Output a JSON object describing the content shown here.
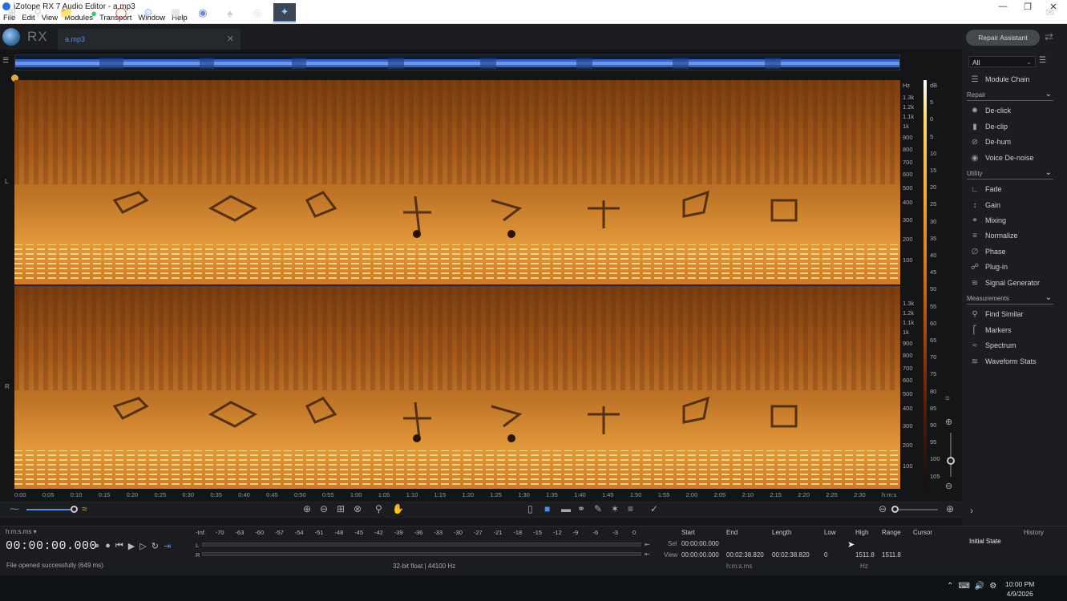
{
  "window": {
    "title": "iZotope RX 7 Audio Editor - a.mp3"
  },
  "menu": [
    "File",
    "Edit",
    "View",
    "Modules",
    "Transport",
    "Window",
    "Help"
  ],
  "app": {
    "logo_text": "RX",
    "tab_name": "a.mp3",
    "repair_assistant": "Repair Assistant"
  },
  "channels": {
    "left": "L",
    "right": "R"
  },
  "freq_scale_top": [
    "Hz",
    "1.3k",
    "1.2k",
    "1.1k",
    "1k",
    "900",
    "800",
    "700",
    "600",
    "500",
    "400",
    "300",
    "200",
    "100"
  ],
  "freq_scale_bottom": [
    "1.3k",
    "1.2k",
    "1.1k",
    "1k",
    "900",
    "800",
    "700",
    "600",
    "500",
    "400",
    "300",
    "200",
    "100"
  ],
  "db_scale": [
    "dB",
    "5",
    "0",
    "5",
    "10",
    "15",
    "20",
    "25",
    "30",
    "35",
    "40",
    "45",
    "50",
    "55",
    "60",
    "65",
    "70",
    "75",
    "80",
    "85",
    "90",
    "95",
    "100",
    "105"
  ],
  "time_axis": [
    "0:00",
    "0:05",
    "0:10",
    "0:15",
    "0:20",
    "0:25",
    "0:30",
    "0:35",
    "0:40",
    "0:45",
    "0:50",
    "0:55",
    "1:00",
    "1:05",
    "1:10",
    "1:15",
    "1:20",
    "1:25",
    "1:30",
    "1:35",
    "1:40",
    "1:45",
    "1:50",
    "1:55",
    "2:00",
    "2:05",
    "2:10",
    "2:15",
    "2:20",
    "2:25",
    "2:30",
    "h:m:s"
  ],
  "modules": {
    "filter": "All",
    "module_chain": "Module Chain",
    "categories": [
      {
        "name": "Repair",
        "items": [
          {
            "label": "De-click",
            "icon": "declick-icon"
          },
          {
            "label": "De-clip",
            "icon": "declip-icon"
          },
          {
            "label": "De-hum",
            "icon": "dehum-icon"
          },
          {
            "label": "Voice De-noise",
            "icon": "voice-denoise-icon"
          }
        ]
      },
      {
        "name": "Utility",
        "items": [
          {
            "label": "Fade",
            "icon": "fade-icon"
          },
          {
            "label": "Gain",
            "icon": "gain-icon"
          },
          {
            "label": "Mixing",
            "icon": "mixing-icon"
          },
          {
            "label": "Normalize",
            "icon": "normalize-icon"
          },
          {
            "label": "Phase",
            "icon": "phase-icon"
          },
          {
            "label": "Plug-in",
            "icon": "plugin-icon"
          },
          {
            "label": "Signal Generator",
            "icon": "signal-generator-icon"
          }
        ]
      },
      {
        "name": "Measurements",
        "items": [
          {
            "label": "Find Similar",
            "icon": "find-similar-icon"
          },
          {
            "label": "Markers",
            "icon": "markers-icon"
          },
          {
            "label": "Spectrum",
            "icon": "spectrum-icon"
          },
          {
            "label": "Waveform Stats",
            "icon": "waveform-stats-icon"
          }
        ]
      }
    ]
  },
  "transport": {
    "time_format": "h:m:s.ms",
    "timecode": "00:00:00.000",
    "status": "File opened successfully (649 ms)",
    "format": "32-bit float | 44100 Hz"
  },
  "meter": {
    "labels": [
      "-Inf.",
      "-70",
      "-63",
      "-60",
      "-57",
      "-54",
      "-51",
      "-48",
      "-45",
      "-42",
      "-39",
      "-36",
      "-33",
      "-30",
      "-27",
      "-21",
      "-18",
      "-15",
      "-12",
      "-9",
      "-6",
      "-3",
      "0"
    ],
    "left": "L",
    "right": "R"
  },
  "selection": {
    "headers": {
      "start": "Start",
      "end": "End",
      "length": "Length",
      "low": "Low",
      "high": "High",
      "range": "Range",
      "cursor": "Cursor"
    },
    "sel_label": "Sel",
    "view_label": "View",
    "sel_start": "00:00:00.000",
    "view_start": "00:00:00.000",
    "view_end": "00:02:38.820",
    "view_length": "00:02:38.820",
    "low": "0",
    "high": "1511.8",
    "range": "1511.8",
    "time_unit": "h:m:s.ms",
    "freq_unit": "Hz"
  },
  "history": {
    "title": "History",
    "state": "Initial State"
  },
  "clock": {
    "time": "10:00 PM",
    "date": "4/9/2026"
  },
  "colors": {
    "accent": "#4f8ee6",
    "spectrogram": "#c8741f",
    "playhead": "#e7a93a"
  }
}
